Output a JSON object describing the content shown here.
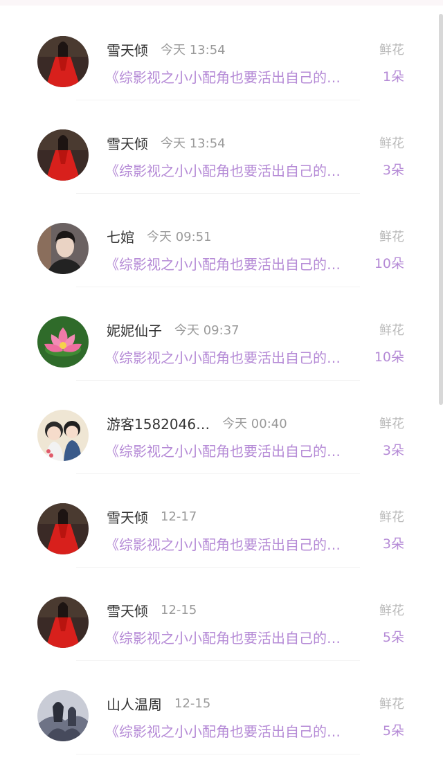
{
  "items": [
    {
      "name": "雪天倾",
      "time": "今天 13:54",
      "gift_type": "鲜花",
      "book": "《综影视之小小配角也要活出自己的…",
      "count": "1朵",
      "avatar": "red-dress-woman"
    },
    {
      "name": "雪天倾",
      "time": "今天 13:54",
      "gift_type": "鲜花",
      "book": "《综影视之小小配角也要活出自己的…",
      "count": "3朵",
      "avatar": "red-dress-woman"
    },
    {
      "name": "七婠",
      "time": "今天 09:51",
      "gift_type": "鲜花",
      "book": "《综影视之小小配角也要活出自己的…",
      "count": "10朵",
      "avatar": "young-man"
    },
    {
      "name": "妮妮仙子",
      "time": "今天 09:37",
      "gift_type": "鲜花",
      "book": "《综影视之小小配角也要活出自己的…",
      "count": "10朵",
      "avatar": "lotus-flower"
    },
    {
      "name": "游客1582046…",
      "time": "今天 00:40",
      "gift_type": "鲜花",
      "book": "《综影视之小小配角也要活出自己的…",
      "count": "3朵",
      "avatar": "cartoon-couple"
    },
    {
      "name": "雪天倾",
      "time": "12-17",
      "gift_type": "鲜花",
      "book": "《综影视之小小配角也要活出自己的…",
      "count": "3朵",
      "avatar": "red-dress-woman"
    },
    {
      "name": "雪天倾",
      "time": "12-15",
      "gift_type": "鲜花",
      "book": "《综影视之小小配角也要活出自己的…",
      "count": "5朵",
      "avatar": "red-dress-woman"
    },
    {
      "name": "山人温周",
      "time": "12-15",
      "gift_type": "鲜花",
      "book": "《综影视之小小配角也要活出自己的…",
      "count": "5朵",
      "avatar": "ink-painting-figures"
    }
  ],
  "colors": {
    "accent": "#b58ad6",
    "name": "#333333",
    "time": "#9a9a9a",
    "gift_type": "#b9b9b9"
  }
}
